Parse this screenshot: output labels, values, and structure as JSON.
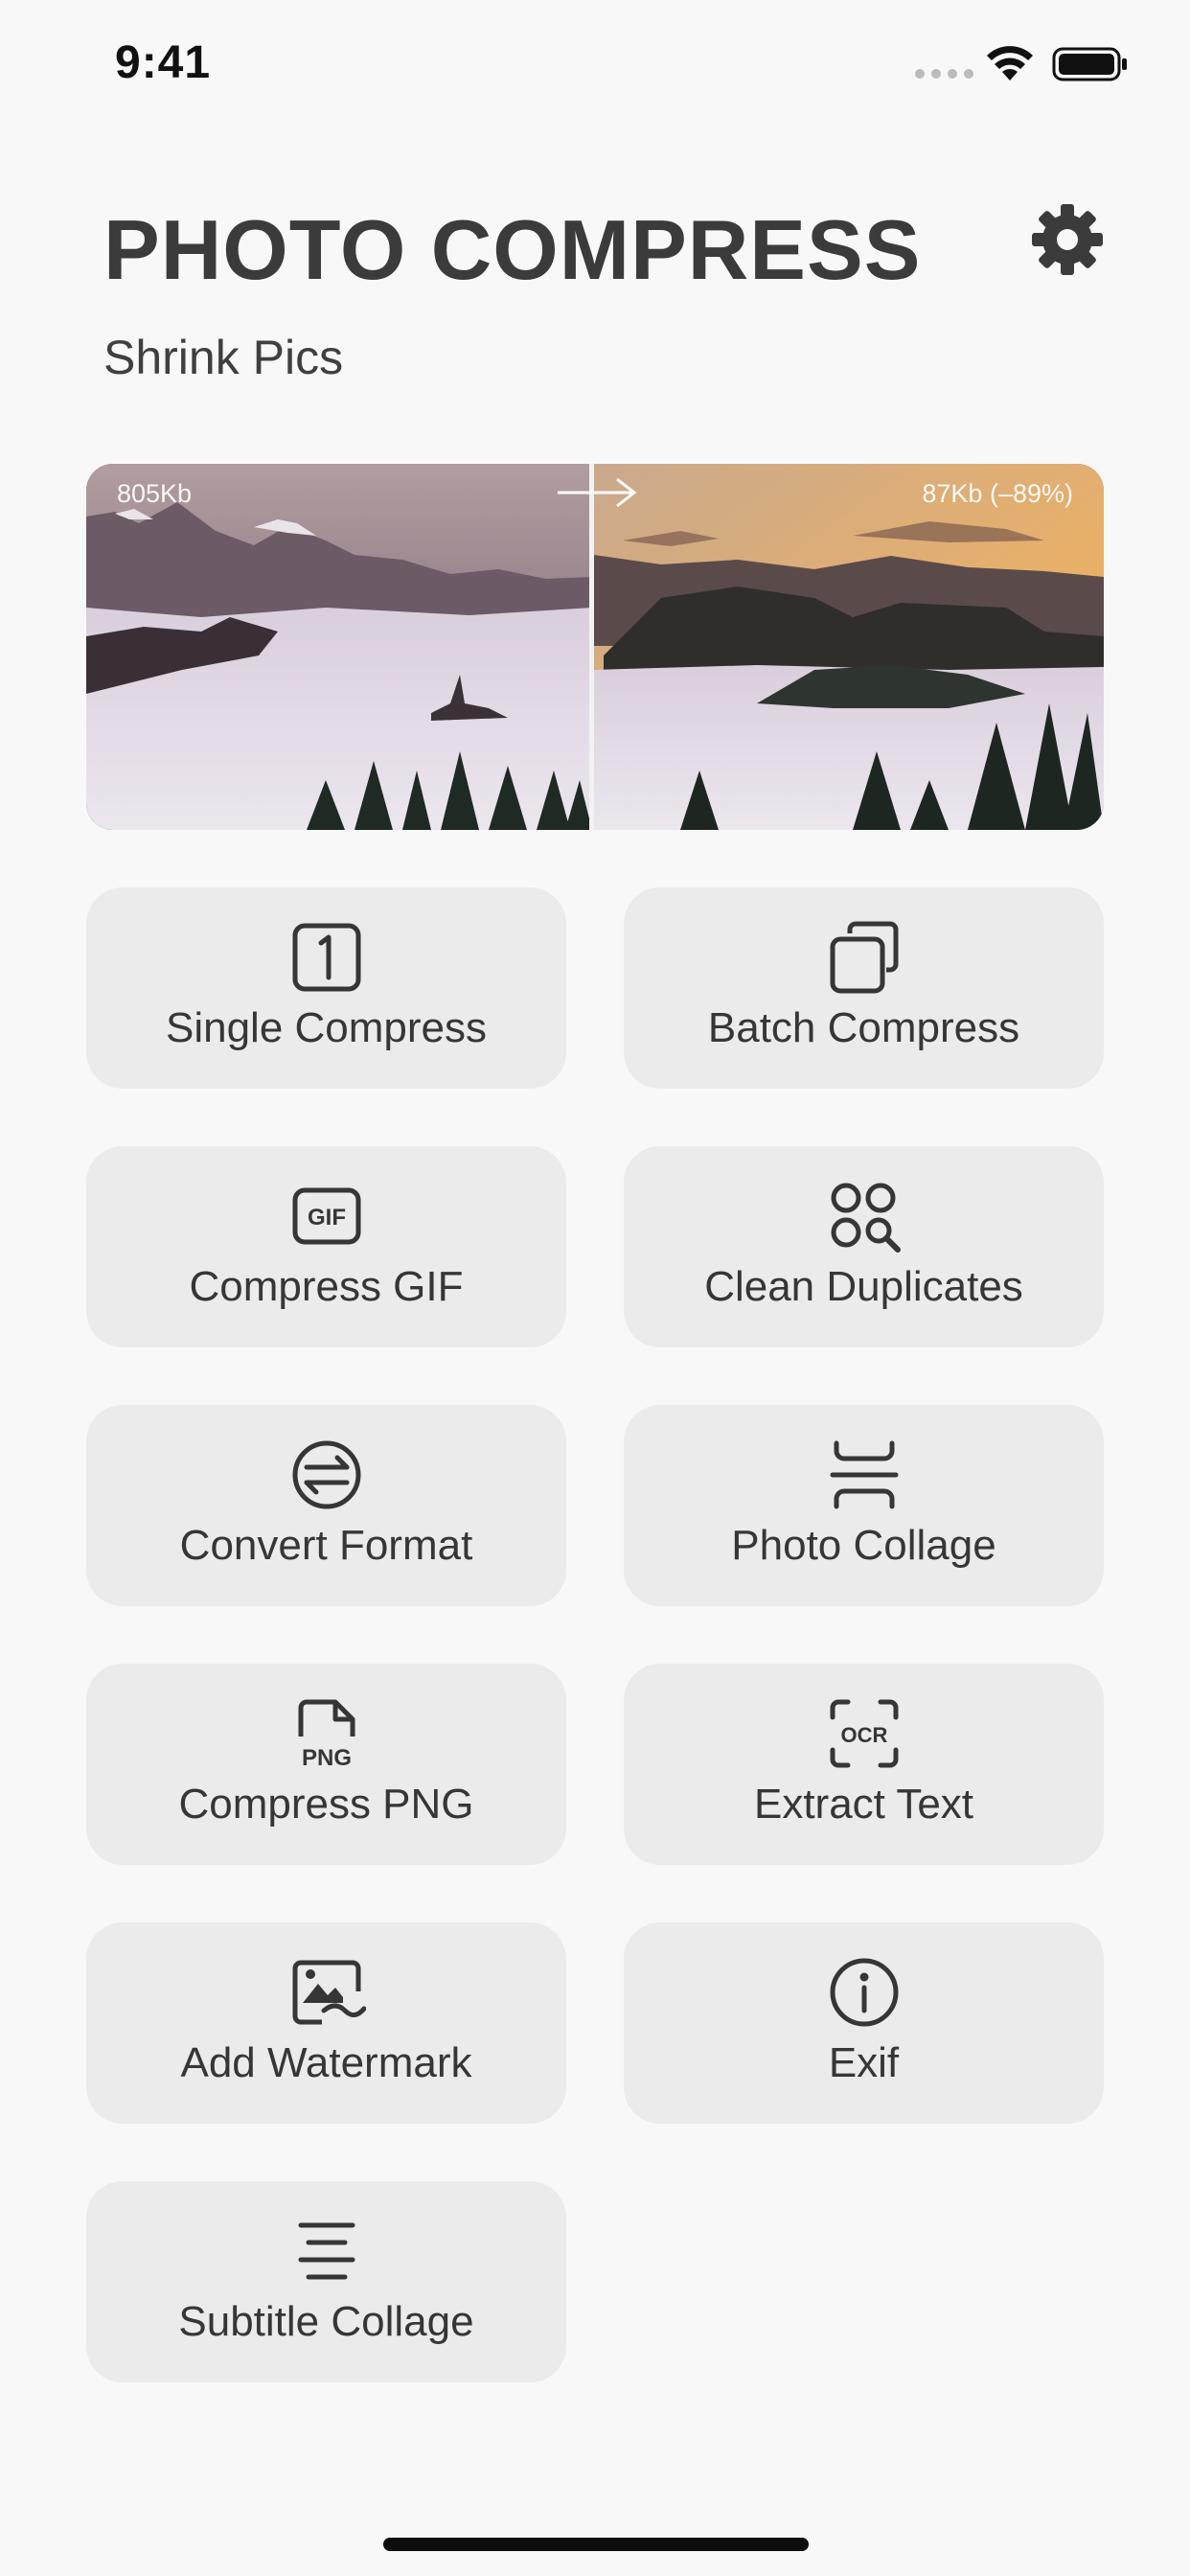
{
  "status_bar": {
    "time": "9:41"
  },
  "header": {
    "title": "PHOTO COMPRESS",
    "subtitle": "Shrink Pics"
  },
  "preview": {
    "before_size": "805Kb",
    "after_size": "87Kb (–89%)"
  },
  "tiles": [
    {
      "label": "Single Compress",
      "icon": "single-image-icon"
    },
    {
      "label": "Batch Compress",
      "icon": "stacked-images-icon"
    },
    {
      "label": "Compress GIF",
      "icon": "gif-icon"
    },
    {
      "label": "Clean Duplicates",
      "icon": "duplicate-search-icon"
    },
    {
      "label": "Convert Format",
      "icon": "swap-arrows-icon"
    },
    {
      "label": "Photo Collage",
      "icon": "collage-icon"
    },
    {
      "label": "Compress PNG",
      "icon": "png-file-icon",
      "icon_text": "PNG"
    },
    {
      "label": "Extract Text",
      "icon": "ocr-scan-icon",
      "icon_text": "OCR"
    },
    {
      "label": "Add Watermark",
      "icon": "watermark-image-icon"
    },
    {
      "label": "Exif",
      "icon": "info-icon"
    },
    {
      "label": "Subtitle Collage",
      "icon": "subtitle-lines-icon"
    }
  ],
  "colors": {
    "background": "#f8f8f8",
    "tile": "#ebebeb",
    "text": "#363636"
  }
}
